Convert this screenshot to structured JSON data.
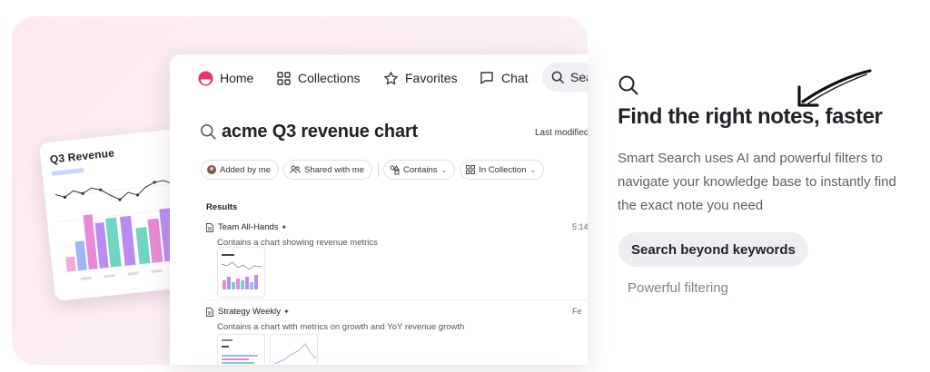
{
  "nav": {
    "home": "Home",
    "collections": "Collections",
    "favorites": "Favorites",
    "chat": "Chat",
    "search": "Sea"
  },
  "search": {
    "query": "acme Q3 revenue chart",
    "sort_label": "Last modified"
  },
  "filters": [
    {
      "label": "Added by me"
    },
    {
      "label": "Shared with me"
    },
    {
      "label": "Contains"
    },
    {
      "label": "In Collection"
    }
  ],
  "results": {
    "label": "Results",
    "items": [
      {
        "title": "Team All-Hands",
        "description": "Contains a chart showing revenue metrics",
        "time": "5:14"
      },
      {
        "title": "Strategy Weekly",
        "description": "Contains a chart with metrics on growth and YoY revenue growth",
        "time": "Fe"
      }
    ]
  },
  "preview_card": {
    "title": "Q3 Revenue"
  },
  "feature": {
    "title": "Find the right notes, faster",
    "description": "Smart Search uses AI and powerful filters to navigate your knowledge base to instantly find the exact note you need",
    "primary_button": "Search beyond keywords",
    "secondary_link": "Powerful filtering"
  },
  "colors": {
    "accent_pink": "#e8336b",
    "bar_purple": "#b78ef0",
    "bar_teal": "#6fd6c6",
    "bar_pink": "#e68ad6",
    "bar_blue": "#9fb6f5"
  }
}
